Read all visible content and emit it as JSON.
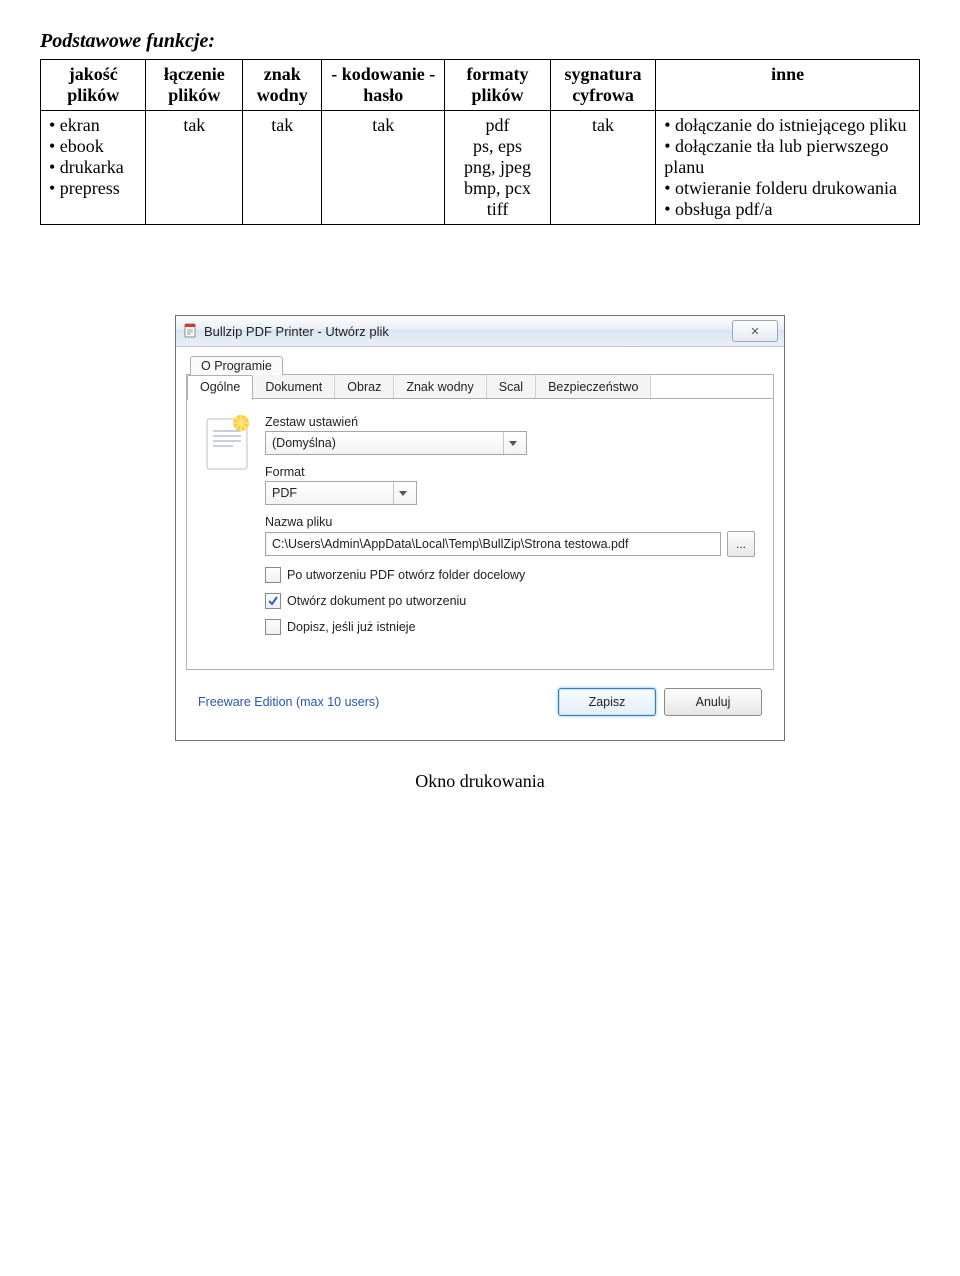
{
  "heading": "Podstawowe funkcje:",
  "table": {
    "headers": [
      "jakość plików",
      "łączenie plików",
      "znak wodny",
      "- kodowanie - hasło",
      "formaty plików",
      "sygnatura cyfrowa",
      "inne"
    ],
    "row": {
      "quality": "• ekran\n• ebook\n• drukarka\n• prepress",
      "merge": "tak",
      "watermark": "tak",
      "encoding": "tak",
      "formats": "pdf\nps, eps\npng, jpeg\nbmp, pcx\ntiff",
      "signature": "tak",
      "other": "• dołączanie do istniejącego pliku\n• dołączanie tła lub pierwszego planu\n• otwieranie folderu drukowania\n• obsługa pdf/a"
    }
  },
  "dialog": {
    "title": "Bullzip PDF Printer - Utwórz plik",
    "close_label": "✕",
    "about_tab": "O Programie",
    "tabs": [
      "Ogólne",
      "Dokument",
      "Obraz",
      "Znak wodny",
      "Scal",
      "Bezpieczeństwo"
    ],
    "settings_label": "Zestaw ustawień",
    "settings_value": "(Domyślna)",
    "format_label": "Format",
    "format_value": "PDF",
    "filename_label": "Nazwa pliku",
    "filename_value": "C:\\Users\\Admin\\AppData\\Local\\Temp\\BullZip\\Strona testowa.pdf",
    "browse_label": "...",
    "check1": "Po utworzeniu PDF otwórz folder docelowy",
    "check2": "Otwórz dokument po utworzeniu",
    "check3": "Dopisz, jeśli już istnieje",
    "freeware": "Freeware Edition (max 10 users)",
    "save_label": "Zapisz",
    "cancel_label": "Anuluj"
  },
  "caption": "Okno drukowania"
}
